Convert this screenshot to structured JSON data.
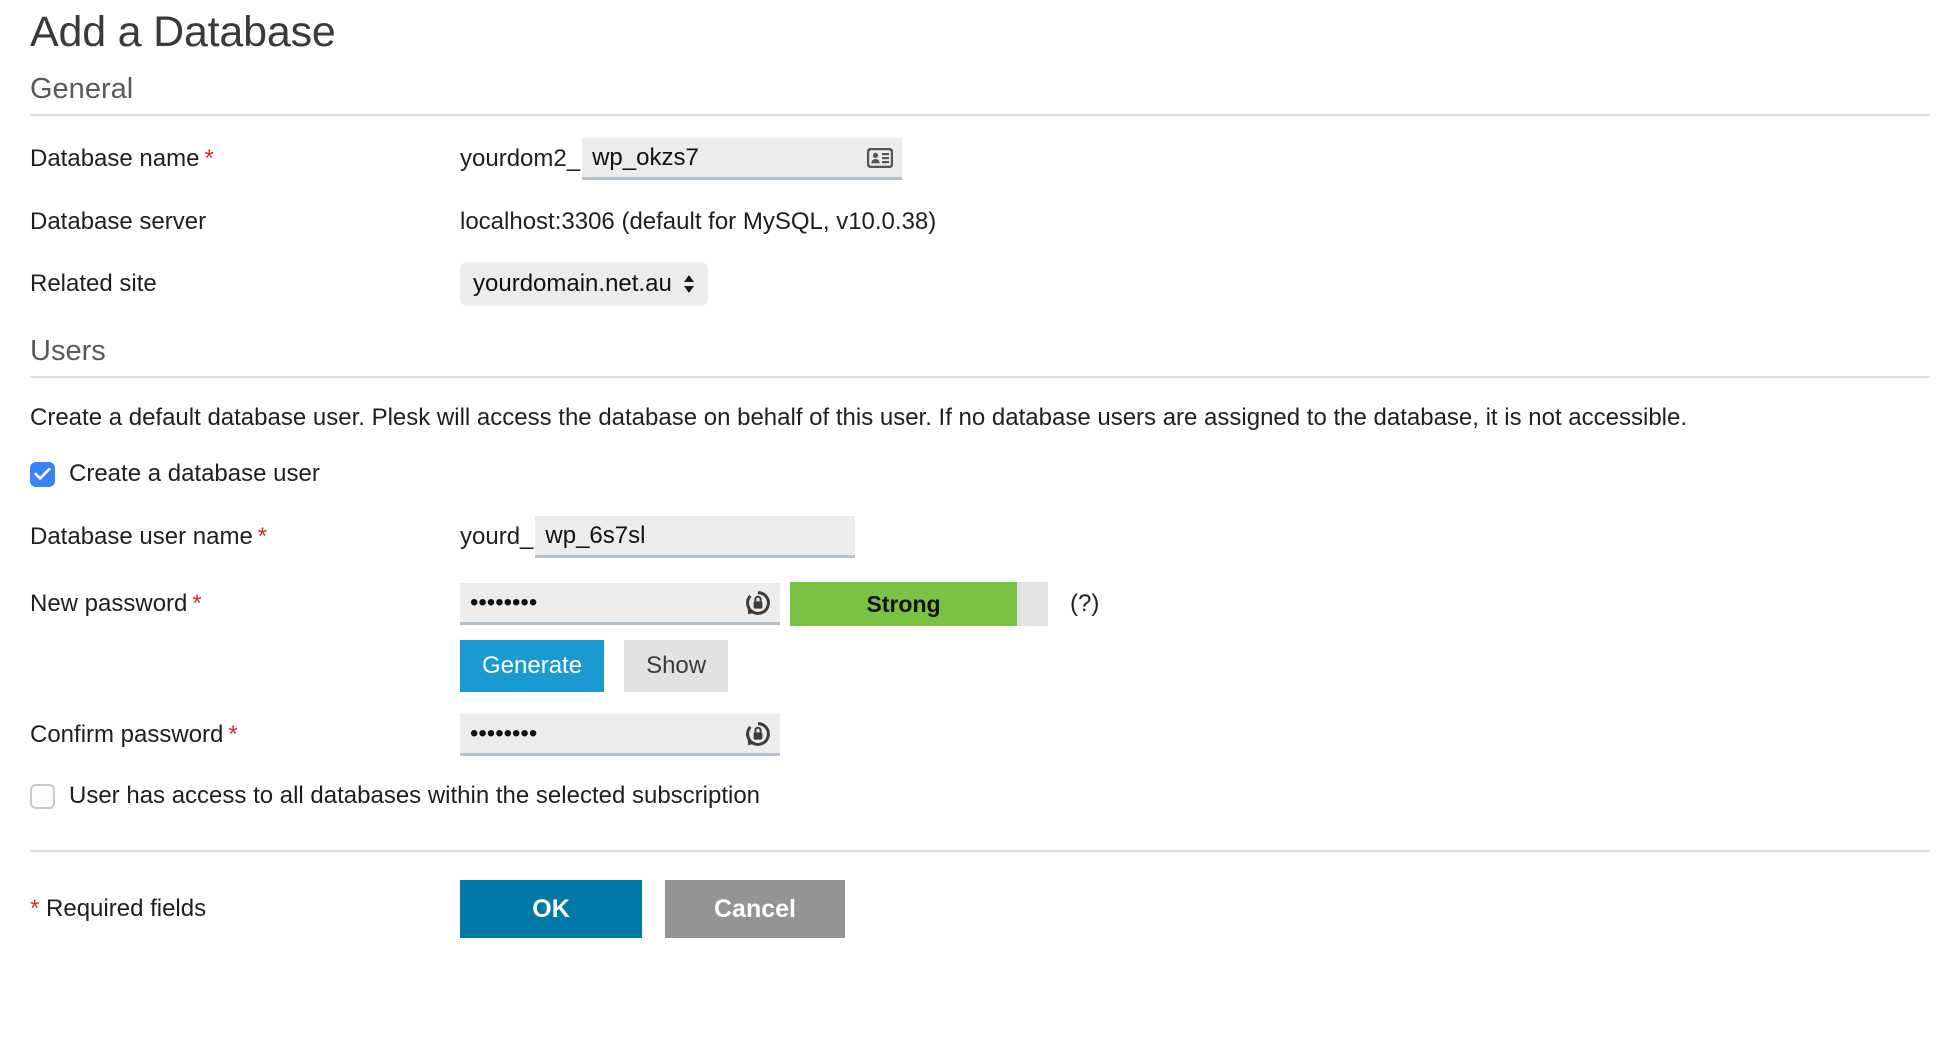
{
  "page": {
    "title": "Add a Database"
  },
  "sections": {
    "general": {
      "heading": "General",
      "database_name": {
        "label": "Database name",
        "required_marker": "*",
        "prefix": "yourdom2_",
        "value": "wp_okzs7",
        "icon": "address-card-icon"
      },
      "database_server": {
        "label": "Database server",
        "value": "localhost:3306 (default for MySQL, v10.0.38)"
      },
      "related_site": {
        "label": "Related site",
        "selected": "yourdomain.net.au",
        "icon": "updown-arrows-icon"
      }
    },
    "users": {
      "heading": "Users",
      "description": "Create a default database user. Plesk will access the database on behalf of this user. If no database users are assigned to the database, it is not accessible.",
      "create_user_checkbox": {
        "label": "Create a database user",
        "checked": true
      },
      "database_user_name": {
        "label": "Database user name",
        "required_marker": "*",
        "prefix": "yourd_",
        "value": "wp_6s7sl"
      },
      "new_password": {
        "label": "New password",
        "required_marker": "*",
        "value": "••••••••",
        "icon": "password-lock-icon",
        "strength_label": "Strong",
        "strength_percent": 88,
        "strength_color": "#7cc242",
        "help_label": "(?)"
      },
      "generate_button": "Generate",
      "show_button": "Show",
      "confirm_password": {
        "label": "Confirm password",
        "required_marker": "*",
        "value": "••••••••",
        "icon": "password-lock-icon"
      },
      "all_databases_checkbox": {
        "label": "User has access to all databases within the selected subscription",
        "checked": false
      }
    }
  },
  "footer": {
    "required_star": "*",
    "required_note": "Required fields",
    "ok_button": "OK",
    "cancel_button": "Cancel"
  }
}
